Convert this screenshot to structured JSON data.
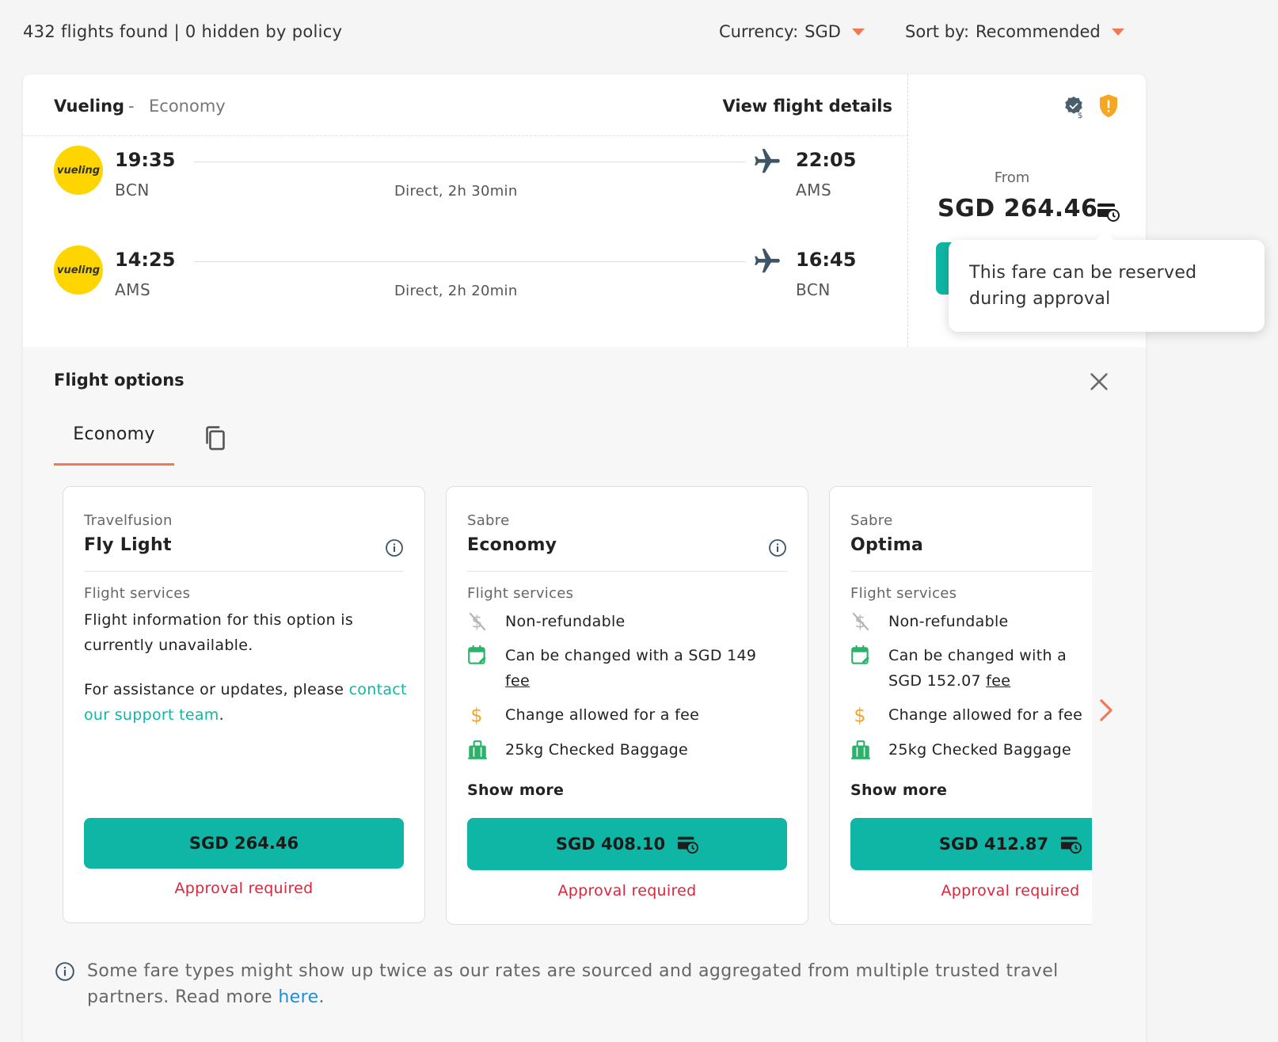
{
  "toolbar": {
    "results": "432 flights found | 0 hidden by policy",
    "currency_label": "Currency:",
    "currency_value": "SGD",
    "sort_label": "Sort by:",
    "sort_value": "Recommended"
  },
  "flight": {
    "airline": "Vueling",
    "separator": "-",
    "cabin": "Economy",
    "view_details": "View flight details",
    "legs": [
      {
        "logo": "vueling",
        "dep_time": "19:35",
        "dep_code": "BCN",
        "arr_time": "22:05",
        "arr_code": "AMS",
        "duration": "Direct, 2h 30min"
      },
      {
        "logo": "vueling",
        "dep_time": "14:25",
        "dep_code": "AMS",
        "arr_time": "16:45",
        "arr_code": "BCN",
        "duration": "Direct, 2h 20min"
      }
    ],
    "from_label": "From",
    "from_price": "SGD 264.46",
    "tooltip": "This fare can be reserved during approval"
  },
  "options": {
    "title": "Flight options",
    "tabs": [
      {
        "label": "Economy"
      }
    ],
    "fares": [
      {
        "source": "Travelfusion",
        "name": "Fly Light",
        "services_label": "Flight services",
        "unavailable": "Flight information for this option is currently unavailable.",
        "assist_prefix": "For assistance or updates, please ",
        "assist_link": "contact our support team",
        "assist_suffix": ".",
        "price": "SGD 264.46",
        "approval": "Approval required"
      },
      {
        "source": "Sabre",
        "name": "Economy",
        "services_label": "Flight services",
        "services": [
          {
            "icon": "no-refund-icon",
            "text": "Non-refundable"
          },
          {
            "icon": "calendar-change-icon",
            "text": "Can be changed with a SGD 149",
            "fee": "fee"
          },
          {
            "icon": "dollar-icon",
            "text": "Change allowed for a fee"
          },
          {
            "icon": "baggage-icon",
            "text": "25kg Checked Baggage"
          }
        ],
        "show_more": "Show more",
        "price": "SGD 408.10",
        "approval": "Approval required"
      },
      {
        "source": "Sabre",
        "name": "Optima",
        "services_label": "Flight services",
        "services": [
          {
            "icon": "no-refund-icon",
            "text": "Non-refundable"
          },
          {
            "icon": "calendar-change-icon",
            "text": "Can be changed with a SGD 152.07",
            "fee": "fee"
          },
          {
            "icon": "dollar-icon",
            "text": "Change allowed for a fee"
          },
          {
            "icon": "baggage-icon",
            "text": "25kg Checked Baggage"
          }
        ],
        "show_more": "Show more",
        "price": "SGD 412.87",
        "approval": "Approval required"
      }
    ],
    "footnote_text": "Some fare types might show up twice as our rates are sourced and aggregated from multiple trusted travel partners. Read more ",
    "footnote_link": "here",
    "footnote_end": "."
  },
  "colors": {
    "accent": "#0fb6a5",
    "caret": "#f07a55",
    "approval": "#d9263b",
    "link": "#1a8fe0",
    "airline_logo": "#ffd500",
    "policy_warning": "#f5a623"
  }
}
